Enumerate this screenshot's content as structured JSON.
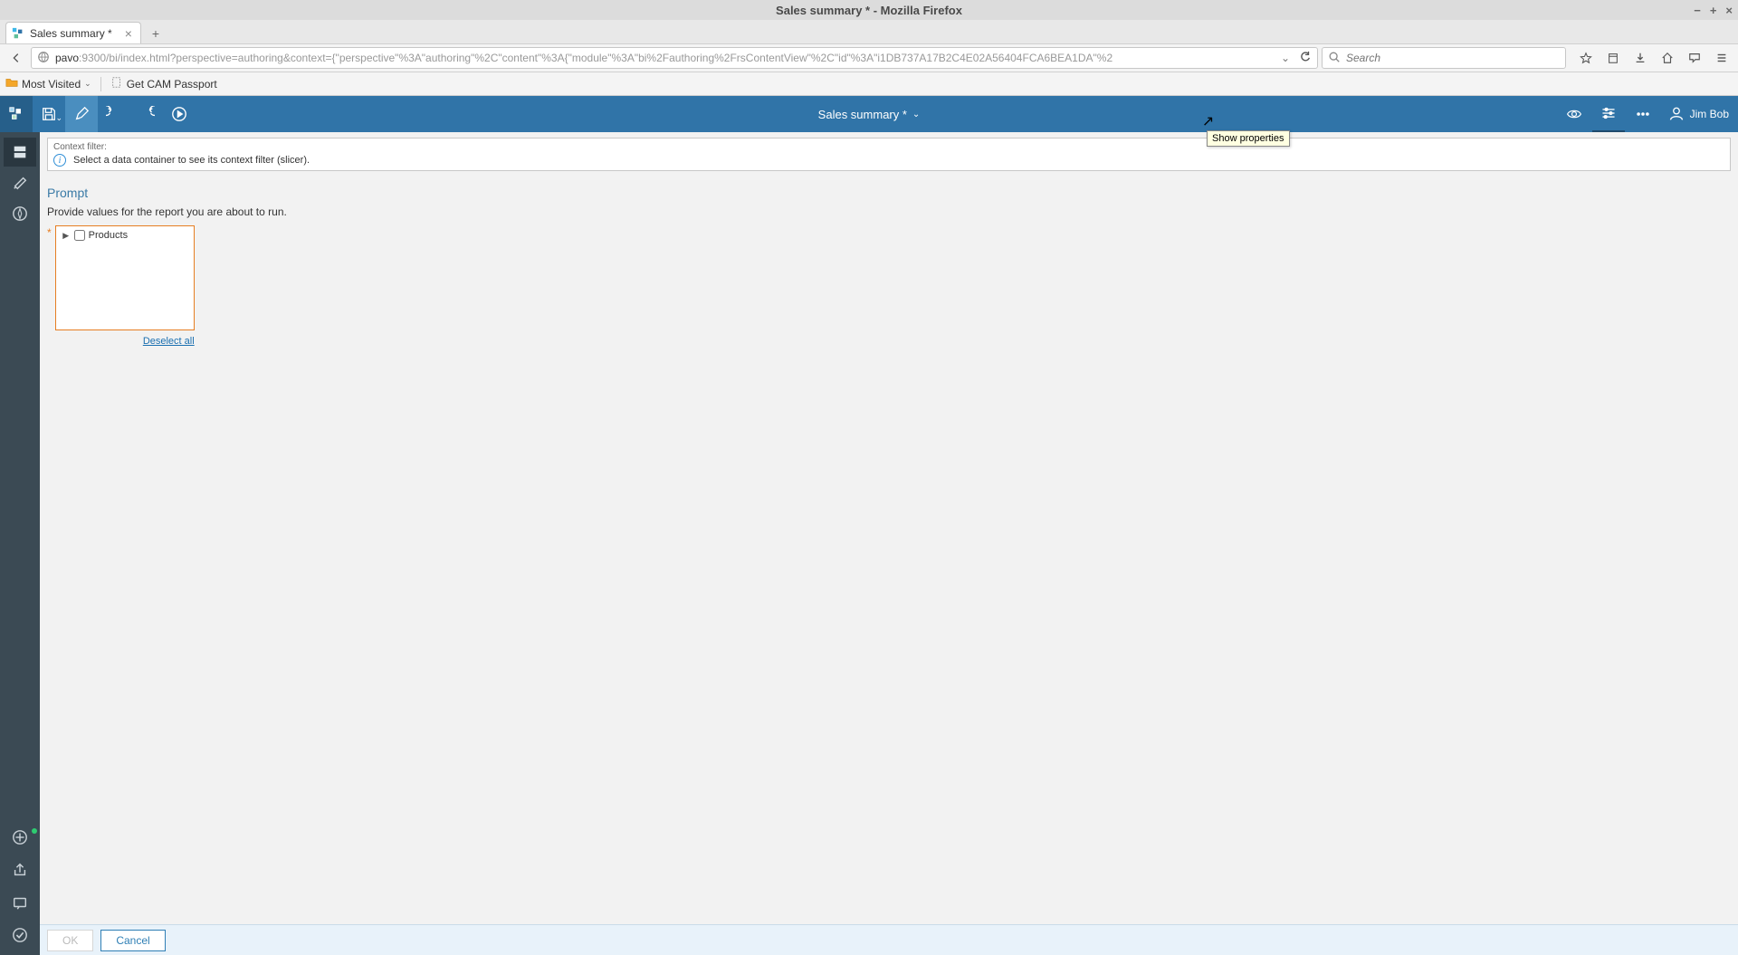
{
  "os": {
    "title": "Sales summary * - Mozilla Firefox",
    "win_min": "−",
    "win_max": "+",
    "win_close": "×"
  },
  "browser": {
    "tab_title": "Sales summary *",
    "url_host": "pavo",
    "url_path": ":9300/bi/index.html?perspective=authoring&context={\"perspective\"%3A\"authoring\"%2C\"content\"%3A{\"module\"%3A\"bi%2Fauthoring%2FrsContentView\"%2C\"id\"%3A\"i1DB737A17B2C4E02A56404FCA6BEA1DA\"%2",
    "search_placeholder": "Search",
    "bookmarks": {
      "most_visited": "Most Visited",
      "get_cam": "Get CAM Passport"
    }
  },
  "app": {
    "report_title": "Sales summary *",
    "username": "Jim Bob",
    "tooltip_properties": "Show properties",
    "context_filter": {
      "label": "Context filter:",
      "message": "Select a data container to see its context filter (slicer)."
    },
    "prompt": {
      "title": "Prompt",
      "desc": "Provide values for the report you are about to run.",
      "tree_root": "Products",
      "deselect": "Deselect all"
    },
    "buttons": {
      "ok": "OK",
      "cancel": "Cancel"
    }
  }
}
